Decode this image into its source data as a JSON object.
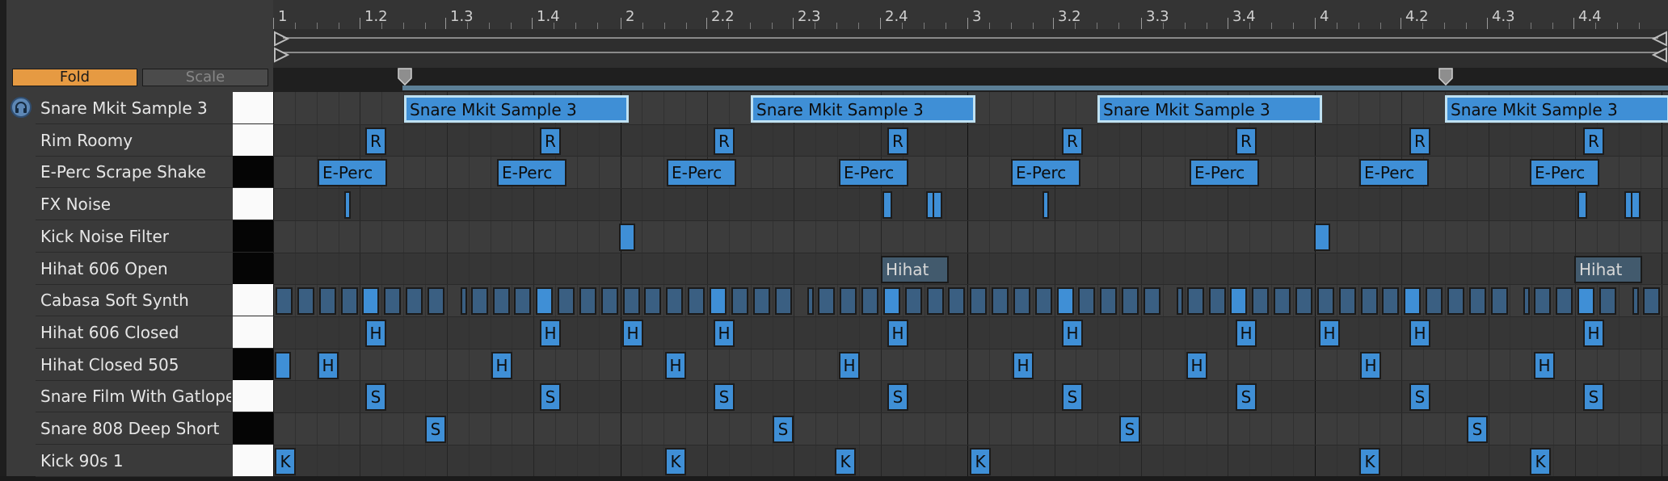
{
  "toolbar": {
    "fold_label": "Fold",
    "scale_label": "Scale"
  },
  "ruler": {
    "labels": [
      "1",
      "1.2",
      "1.3",
      "1.4",
      "2",
      "2.2",
      "2.3",
      "2.4",
      "3",
      "3.2",
      "3.3",
      "3.4",
      "4",
      "4.2",
      "4.3",
      "4.4"
    ]
  },
  "rows": [
    {
      "label": "Snare Mkit Sample 3",
      "key": "white"
    },
    {
      "label": "Rim Roomy",
      "key": "white"
    },
    {
      "label": "E-Perc Scrape Shake",
      "key": "black"
    },
    {
      "label": "FX Noise",
      "key": "white"
    },
    {
      "label": "Kick Noise Filter",
      "key": "black"
    },
    {
      "label": "Hihat 606 Open",
      "key": "black"
    },
    {
      "label": "Cabasa Soft Synth",
      "key": "white"
    },
    {
      "label": "Hihat 606 Closed",
      "key": "white"
    },
    {
      "label": "Hihat Closed 505",
      "key": "black"
    },
    {
      "label": "Snare Film With Gatlope",
      "key": "white"
    },
    {
      "label": "Snare 808 Deep Short",
      "key": "black"
    },
    {
      "label": "Kick 90s 1",
      "key": "white"
    }
  ],
  "notes": {
    "snare_mkit": "Snare Mkit Sample 3",
    "rim": "R",
    "eperc": "E-Perc",
    "hihat_open": "Hihat",
    "hihat_closed": "H",
    "snare_film": "S",
    "snare_808": "S",
    "kick": "K"
  },
  "colors": {
    "note": "#3f8fd6",
    "note_selected_border": "#bfe1f2",
    "fold_button": "#e69a42",
    "preview": "#5d87b5"
  },
  "icons": [
    "headphones-icon",
    "loop-start-icon",
    "loop-end-icon",
    "marker-icon"
  ]
}
